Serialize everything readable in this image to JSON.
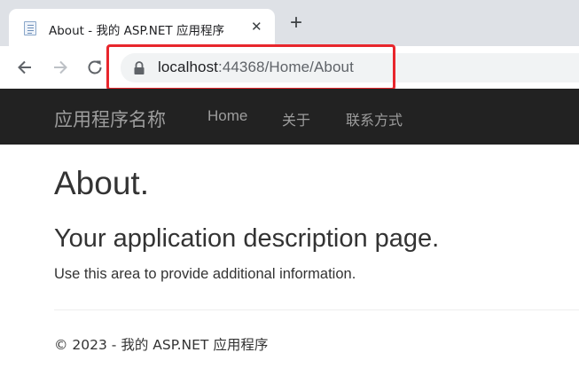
{
  "browser": {
    "tab": {
      "title": "About - 我的 ASP.NET 应用程序",
      "favicon": "page-icon"
    },
    "new_tab_label": "+",
    "close_label": "✕",
    "address": {
      "host": "localhost",
      "path": ":44368/Home/About",
      "secure_icon": "lock-icon"
    },
    "highlight_color": "#e8262c"
  },
  "site": {
    "brand": "应用程序名称",
    "nav": [
      {
        "label": "Home"
      },
      {
        "label": "关于"
      },
      {
        "label": "联系方式"
      }
    ],
    "navbar_color": "#222222",
    "link_color": "#9d9d9d"
  },
  "content": {
    "title": "About.",
    "subtitle": "Your application description page.",
    "body": "Use this area to provide additional information."
  },
  "footer": {
    "text": "© 2023 - 我的 ASP.NET 应用程序"
  }
}
